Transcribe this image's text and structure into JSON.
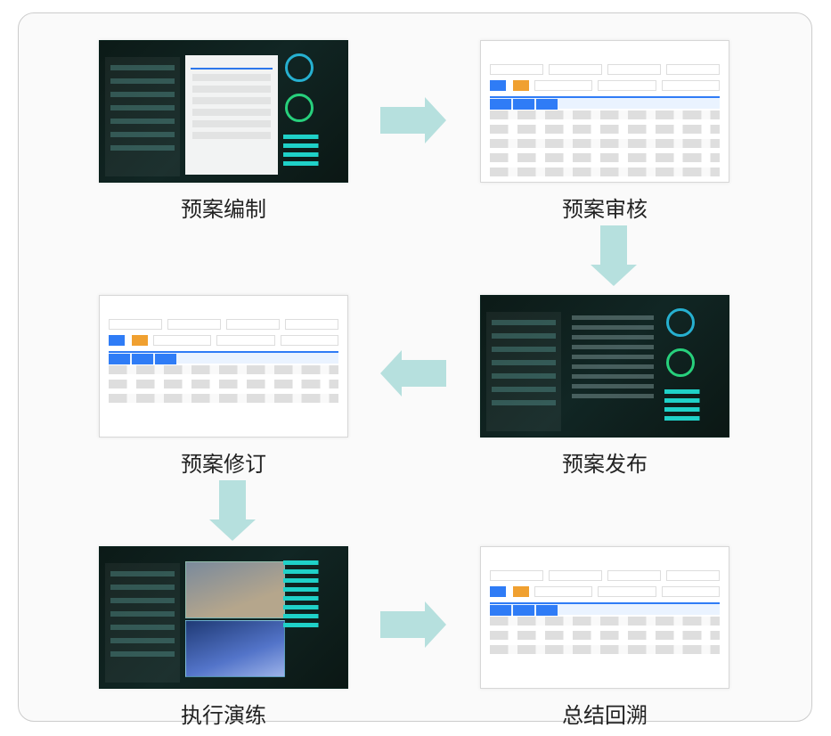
{
  "diagram": {
    "steps": [
      {
        "key": "compile",
        "label": "预案编制",
        "style": "dark-form"
      },
      {
        "key": "review",
        "label": "预案审核",
        "style": "light-table"
      },
      {
        "key": "revise",
        "label": "预案修订",
        "style": "light-table"
      },
      {
        "key": "publish",
        "label": "预案发布",
        "style": "dark-article"
      },
      {
        "key": "drill",
        "label": "执行演练",
        "style": "dark-camera"
      },
      {
        "key": "summary",
        "label": "总结回溯",
        "style": "light-table"
      }
    ],
    "flow": [
      {
        "from": "compile",
        "to": "review",
        "dir": "right"
      },
      {
        "from": "review",
        "to": "publish",
        "dir": "down"
      },
      {
        "from": "publish",
        "to": "revise",
        "dir": "left"
      },
      {
        "from": "revise",
        "to": "drill",
        "dir": "down"
      },
      {
        "from": "drill",
        "to": "summary",
        "dir": "right"
      }
    ],
    "colors": {
      "arrow": "#b6e0de",
      "accentBlue": "#2f7cf6",
      "darkBg": "#0c1a17"
    }
  }
}
